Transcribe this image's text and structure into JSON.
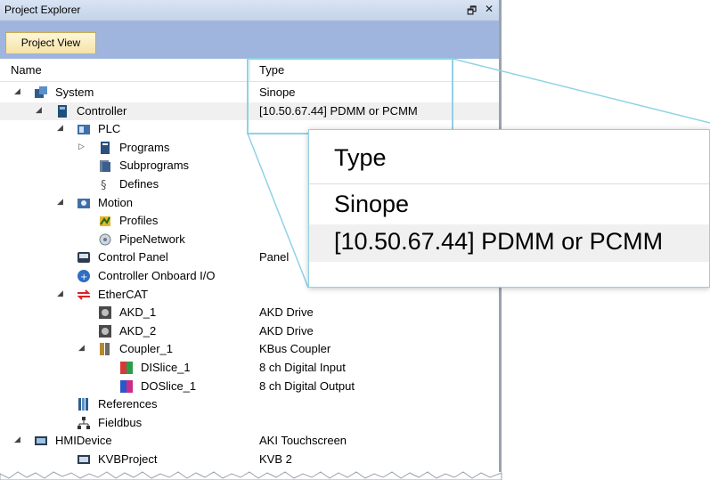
{
  "window": {
    "title": "Project Explorer",
    "pin_glyph": "🗗",
    "close_glyph": "✕"
  },
  "tabs": [
    {
      "label": "Project View",
      "active": true
    }
  ],
  "columns": {
    "name": "Name",
    "type": "Type"
  },
  "tree": [
    {
      "label": "System",
      "type": "Sinope",
      "icon": "system-icon",
      "expander": "expanded"
    },
    {
      "label": "Controller",
      "type": "[10.50.67.44] PDMM or PCMM",
      "icon": "controller-icon",
      "expander": "expanded",
      "selected": true
    },
    {
      "label": "PLC",
      "type": "",
      "icon": "plc-icon",
      "expander": "expanded"
    },
    {
      "label": "Programs",
      "type": "",
      "icon": "programs-icon",
      "expander": "collapsed"
    },
    {
      "label": "Subprograms",
      "type": "",
      "icon": "subprograms-icon",
      "expander": "none"
    },
    {
      "label": "Defines",
      "type": "",
      "icon": "defines-icon",
      "expander": "none"
    },
    {
      "label": "Motion",
      "type": "",
      "icon": "motion-icon",
      "expander": "expanded"
    },
    {
      "label": "Profiles",
      "type": "",
      "icon": "profiles-icon",
      "expander": "none"
    },
    {
      "label": "PipeNetwork",
      "type": "",
      "icon": "pipenetwork-icon",
      "expander": "none"
    },
    {
      "label": "Control Panel",
      "type": "Panel",
      "icon": "control-panel-icon",
      "expander": "none"
    },
    {
      "label": "Controller Onboard I/O",
      "type": "",
      "icon": "onboard-io-icon",
      "expander": "none"
    },
    {
      "label": "EtherCAT",
      "type": "",
      "icon": "ethercat-icon",
      "expander": "expanded"
    },
    {
      "label": "AKD_1",
      "type": "AKD Drive",
      "icon": "drive-icon",
      "expander": "none"
    },
    {
      "label": "AKD_2",
      "type": "AKD Drive",
      "icon": "drive-icon",
      "expander": "none"
    },
    {
      "label": "Coupler_1",
      "type": "KBus Coupler",
      "icon": "coupler-icon",
      "expander": "expanded"
    },
    {
      "label": "DISlice_1",
      "type": "8 ch Digital Input",
      "icon": "digital-input-icon",
      "expander": "none"
    },
    {
      "label": "DOSlice_1",
      "type": "8 ch Digital Output",
      "icon": "digital-output-icon",
      "expander": "none"
    },
    {
      "label": "References",
      "type": "",
      "icon": "references-icon",
      "expander": "none"
    },
    {
      "label": "Fieldbus",
      "type": "",
      "icon": "fieldbus-icon",
      "expander": "none"
    },
    {
      "label": "HMIDevice",
      "type": "AKI Touchscreen",
      "icon": "hmi-device-icon",
      "expander": "expanded"
    },
    {
      "label": "KVBProject",
      "type": "KVB 2",
      "icon": "kvb-project-icon",
      "expander": "none"
    }
  ],
  "zoom": {
    "header": "Type",
    "line1": "Sinope",
    "line2": "[10.50.67.44] PDMM or PCMM"
  },
  "colors": {
    "callout": "#8fd2e5",
    "tab_active": "#f4e2a6",
    "tabbar": "#9fb5dd",
    "titlebar": "#c4d3ea"
  }
}
